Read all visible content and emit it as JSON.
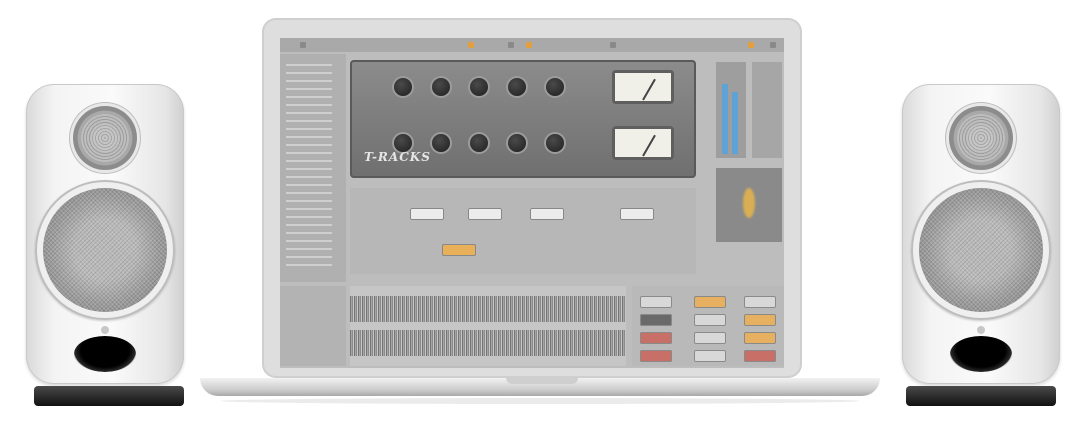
{
  "scene": {
    "subject": "",
    "speakers": 2,
    "speaker_color": "#f2f2f2",
    "laptop_color": "#dedede"
  },
  "screen": {
    "brand_text": "T-RACKS",
    "accent_color": "#e0a040",
    "meter_color": "#5fa3d6"
  }
}
